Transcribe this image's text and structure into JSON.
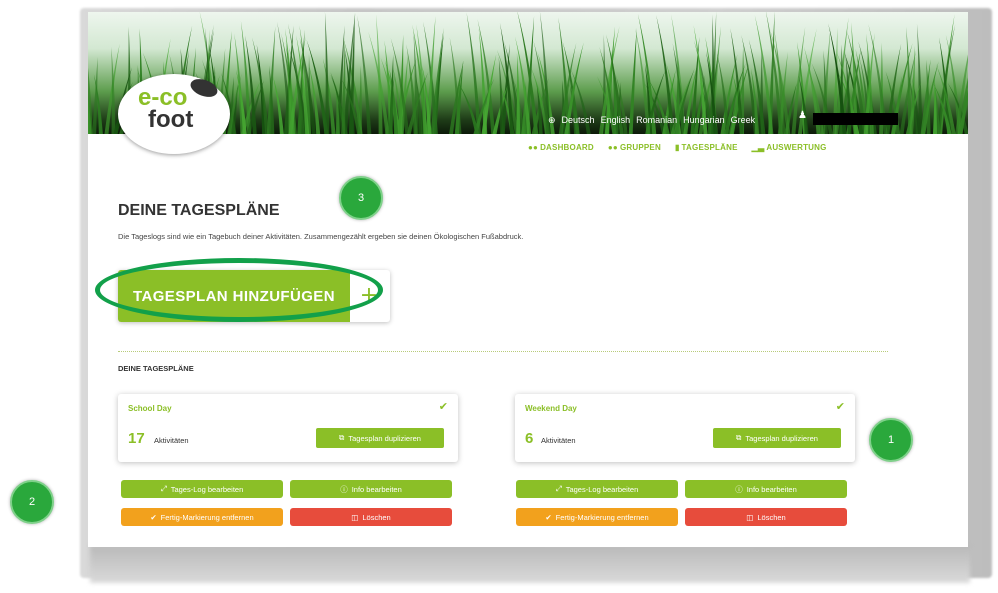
{
  "logo": {
    "line1": "e-co",
    "line2": "foot"
  },
  "languages": [
    "Deutsch",
    "English",
    "Romanian",
    "Hungarian",
    "Greek"
  ],
  "nav": [
    {
      "label": "DASHBOARD",
      "icon": "people-icon"
    },
    {
      "label": "GRUPPEN",
      "icon": "people-icon"
    },
    {
      "label": "TAGESPLÄNE",
      "icon": "document-icon"
    },
    {
      "label": "AUSWERTUNG",
      "icon": "bar-chart-icon"
    }
  ],
  "main": {
    "title": "DEINE TAGESPLÄNE",
    "description": "Die Tageslogs sind wie ein Tagebuch deiner Aktivitäten. Zusammengezählt ergeben sie deinen Ökologischen Fußabdruck.",
    "add_button": "TAGESPLAN HINZUFÜGEN",
    "add_plus": "+",
    "section_title": "DEINE TAGESPLÄNE"
  },
  "plans": [
    {
      "name": "School Day",
      "count": "17",
      "count_label": "Aktivitäten",
      "duplicate": "Tagesplan duplizieren",
      "edit_log": "Tages-Log bearbeiten",
      "edit_info": "Info bearbeiten",
      "unmark": "Fertig-Markierung entfernen",
      "delete": "Löschen"
    },
    {
      "name": "Weekend Day",
      "count": "6",
      "count_label": "Aktivitäten",
      "duplicate": "Tagesplan duplizieren",
      "edit_log": "Tages-Log bearbeiten",
      "edit_info": "Info bearbeiten",
      "unmark": "Fertig-Markierung entfernen",
      "delete": "Löschen"
    }
  ],
  "annotations": {
    "a1": "1",
    "a2": "2",
    "a3": "3"
  },
  "colors": {
    "brand_green": "#8bbf27",
    "orange": "#f2a11d",
    "red": "#e74c3c",
    "annotation_green": "#2aa83c"
  }
}
